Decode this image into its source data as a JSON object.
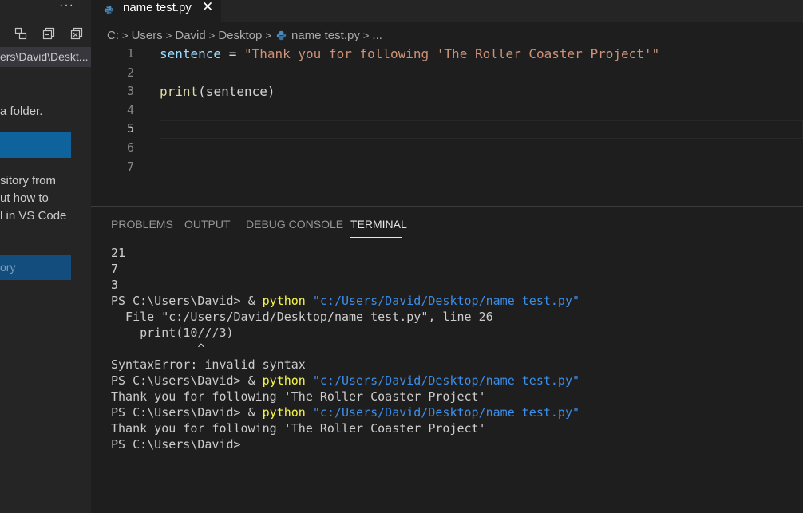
{
  "sidebar": {
    "more_label": "···",
    "path": "ers\\David\\Deskt...",
    "text_line1": "a folder.",
    "text_line2": "sitory from",
    "text_line3": "ut how to",
    "text_line4": "l in VS Code",
    "button2_label": "ory"
  },
  "tab": {
    "label": "name test.py",
    "close": "✕"
  },
  "breadcrumb": {
    "items": [
      "C:",
      "Users",
      "David",
      "Desktop",
      "name test.py",
      "..."
    ]
  },
  "editor": {
    "line_numbers": [
      "1",
      "2",
      "3",
      "4",
      "5",
      "6",
      "7"
    ],
    "line1": {
      "var": "sentence",
      "op": " = ",
      "str": "\"Thank you for following 'The Roller Coaster Project'\""
    },
    "line3": {
      "fn": "print",
      "args": "(sentence)"
    }
  },
  "panel": {
    "tabs": [
      "PROBLEMS",
      "OUTPUT",
      "DEBUG CONSOLE",
      "TERMINAL"
    ],
    "active_tab": "TERMINAL"
  },
  "terminal": {
    "lines": {
      "l0": "21",
      "l1": "7",
      "l2": "3",
      "prompt": "PS C:\\Users\\David> & ",
      "cmd": "python",
      "arg": " \"c:/Users/David/Desktop/name test.py\"",
      "err1": "  File \"c:/Users/David/Desktop/name test.py\", line 26",
      "err2": "    print(10///3)",
      "err3": "            ^",
      "err4": "SyntaxError: invalid syntax",
      "out": "Thank you for following 'The Roller Coaster Project'",
      "final_prompt": "PS C:\\Users\\David>"
    }
  },
  "colors": {
    "editor_bg": "#1e1e1e",
    "sidebar_bg": "#252526",
    "accent_blue": "#0e639c",
    "string": "#ce9178",
    "variable": "#9cdcfe",
    "function": "#dcdcaa",
    "terminal_cmd": "#f5f543",
    "terminal_arg": "#3b8eea"
  }
}
